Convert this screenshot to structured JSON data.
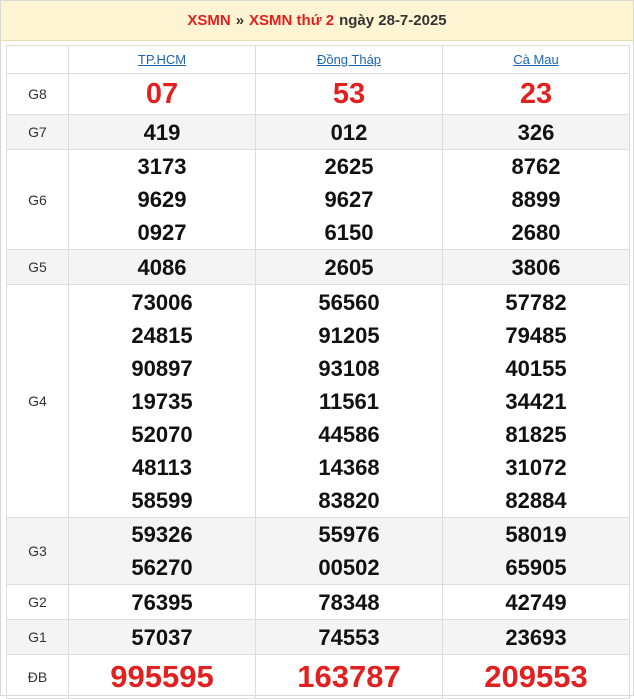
{
  "header": {
    "link1": "XSMN",
    "separator": "»",
    "link2": "XSMN thứ 2",
    "date_text": "ngày 28-7-2025"
  },
  "provinces": [
    "TP.HCM",
    "Đồng Tháp",
    "Cà Mau"
  ],
  "prizes": [
    {
      "label": "G8",
      "values": [
        [
          "07"
        ],
        [
          "53"
        ],
        [
          "23"
        ]
      ]
    },
    {
      "label": "G7",
      "values": [
        [
          "419"
        ],
        [
          "012"
        ],
        [
          "326"
        ]
      ]
    },
    {
      "label": "G6",
      "values": [
        [
          "3173",
          "9629",
          "0927"
        ],
        [
          "2625",
          "9627",
          "6150"
        ],
        [
          "8762",
          "8899",
          "2680"
        ]
      ]
    },
    {
      "label": "G5",
      "values": [
        [
          "4086"
        ],
        [
          "2605"
        ],
        [
          "3806"
        ]
      ]
    },
    {
      "label": "G4",
      "values": [
        [
          "73006",
          "24815",
          "90897",
          "19735",
          "52070",
          "48113",
          "58599"
        ],
        [
          "56560",
          "91205",
          "93108",
          "11561",
          "44586",
          "14368",
          "83820"
        ],
        [
          "57782",
          "79485",
          "40155",
          "34421",
          "81825",
          "31072",
          "82884"
        ]
      ]
    },
    {
      "label": "G3",
      "values": [
        [
          "59326",
          "56270"
        ],
        [
          "55976",
          "00502"
        ],
        [
          "58019",
          "65905"
        ]
      ]
    },
    {
      "label": "G2",
      "values": [
        [
          "76395"
        ],
        [
          "78348"
        ],
        [
          "42749"
        ]
      ]
    },
    {
      "label": "G1",
      "values": [
        [
          "57037"
        ],
        [
          "74553"
        ],
        [
          "23693"
        ]
      ]
    },
    {
      "label": "ĐB",
      "values": [
        [
          "995595"
        ],
        [
          "163787"
        ],
        [
          "209553"
        ]
      ]
    }
  ],
  "colors": {
    "red": "#e32020",
    "link_blue": "#1b64b8",
    "header_bg": "#fff5d2",
    "row_alt": "#f4f4f4"
  }
}
